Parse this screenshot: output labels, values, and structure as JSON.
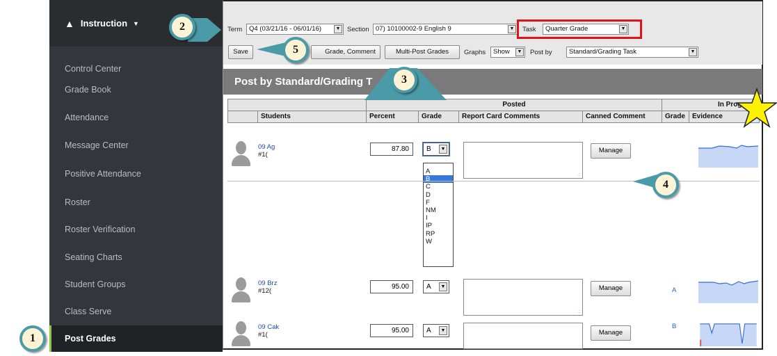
{
  "sidebar": {
    "header": "Instruction",
    "items": [
      {
        "label": "Control Center"
      },
      {
        "label": "Grade Book"
      },
      {
        "label": "Attendance"
      },
      {
        "label": "Message Center"
      },
      {
        "label": "Positive Attendance"
      },
      {
        "label": "Roster"
      },
      {
        "label": "Roster Verification"
      },
      {
        "label": "Seating Charts"
      },
      {
        "label": "Student Groups"
      },
      {
        "label": "Class Serve"
      },
      {
        "label": "Post Grades"
      }
    ]
  },
  "toolbar": {
    "term_label": "Term",
    "term_value": "Q4 (03/21/16 - 06/01/16)",
    "section_label": "Section",
    "section_value": "07) 10100002-9 English 9",
    "task_label": "Task",
    "task_value": "Quarter Grade",
    "save": "Save",
    "grade_comment": "Grade, Comment",
    "multi_post": "Multi-Post Grades",
    "graphs_label": "Graphs",
    "graphs_value": "Show",
    "postby_label": "Post by",
    "postby_value": "Standard/Grading Task"
  },
  "title": "Post by Standard/Grading T",
  "table": {
    "group_posted": "Posted",
    "group_in_progress": "In Progress",
    "columns": [
      "Students",
      "Percent",
      "Grade",
      "Report Card Comments",
      "Canned Comment",
      "Grade",
      "Evidence"
    ]
  },
  "rows": [
    {
      "name": "09 Ag",
      "id": "#1(",
      "percent": "87.80",
      "grade": "B",
      "manage": "Manage",
      "ip_grade": ""
    },
    {
      "name": "09 Brz",
      "id": "#12(",
      "percent": "95.00",
      "grade": "A",
      "manage": "Manage",
      "ip_grade": "A"
    },
    {
      "name": "09 Cak",
      "id": "#1(",
      "percent": "95.00",
      "grade": "A",
      "manage": "Manage",
      "ip_grade": "B"
    }
  ],
  "dropdown_options": [
    "A",
    "B",
    "C",
    "D",
    "F",
    "NM",
    "I",
    "IP",
    "RP",
    "W"
  ],
  "dropdown_selected": "B",
  "callouts": [
    "1",
    "2",
    "3",
    "4",
    "5"
  ],
  "colors": {
    "sidebar": "#33373b",
    "accent": "#8dc63f",
    "highlight": "#e0131d",
    "callout_ring": "#4b9aa8",
    "star": "#fff200"
  }
}
